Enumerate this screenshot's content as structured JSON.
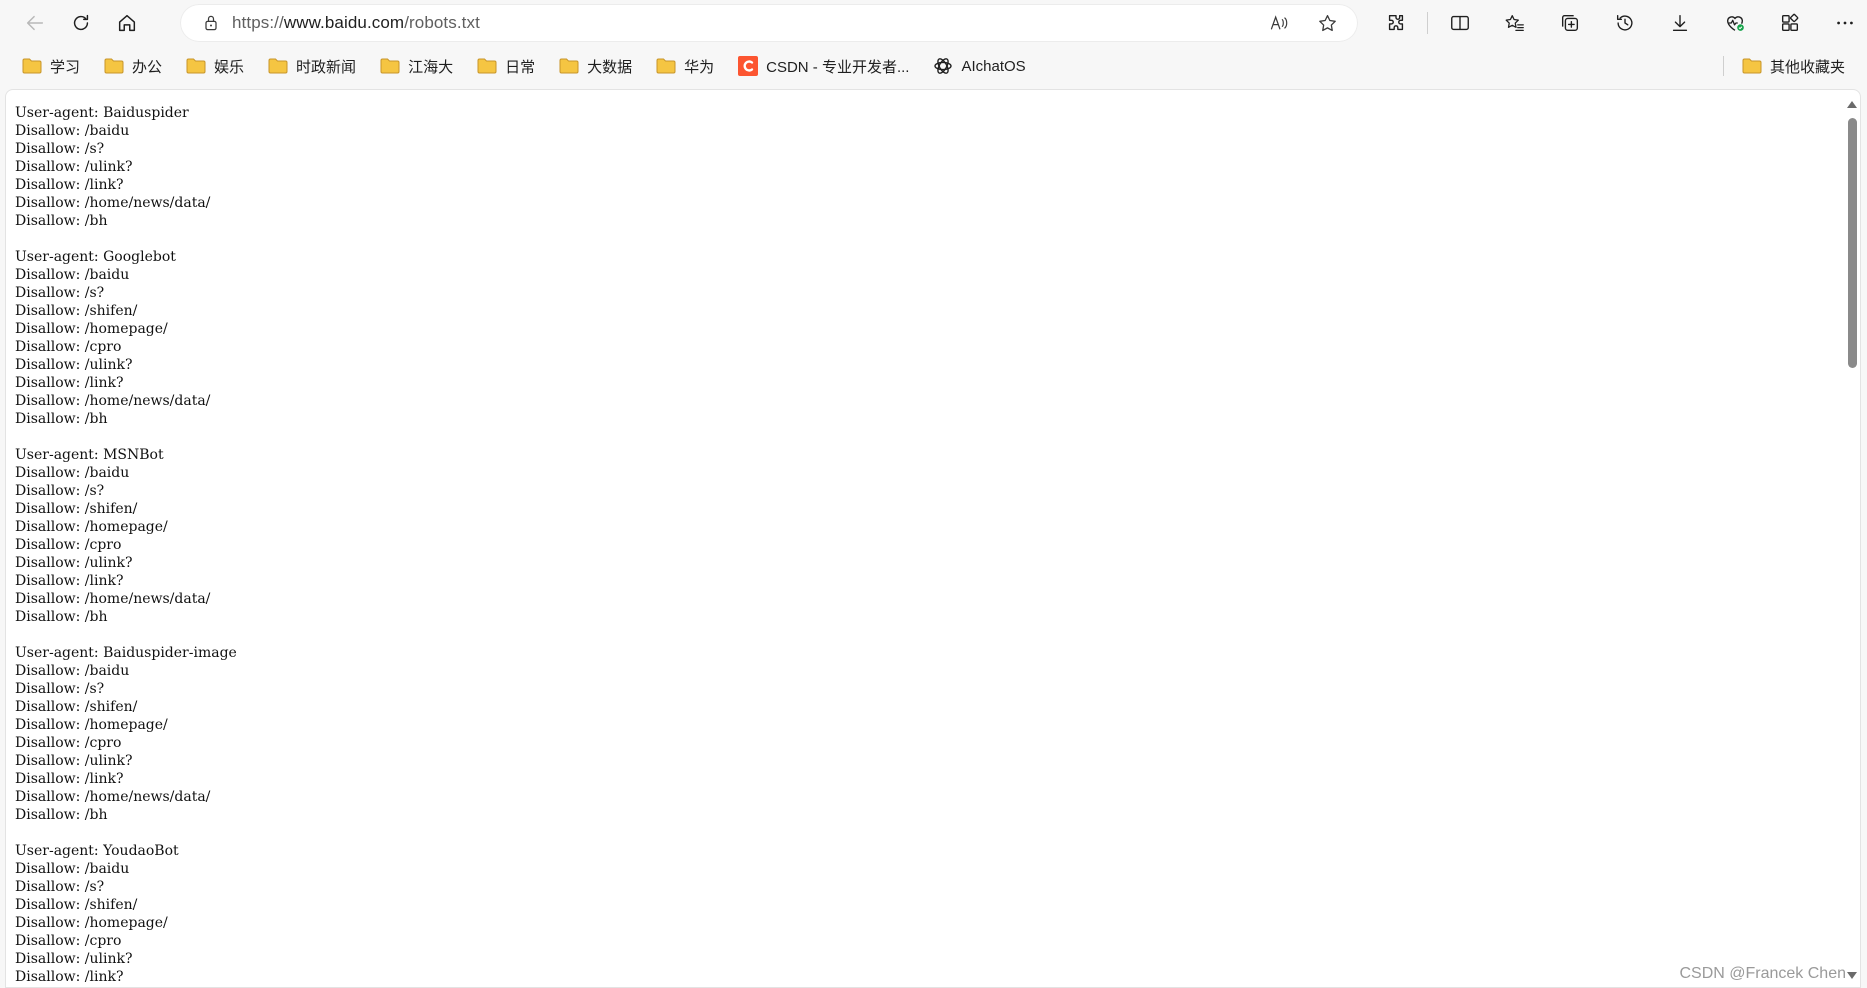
{
  "address_bar": {
    "url_prefix": "https://",
    "url_domain": "www.baidu.com",
    "url_path": "/robots.txt"
  },
  "favorites": [
    {
      "label": "学习",
      "icon": "folder-icon"
    },
    {
      "label": "办公",
      "icon": "folder-icon"
    },
    {
      "label": "娱乐",
      "icon": "folder-icon"
    },
    {
      "label": "时政新闻",
      "icon": "folder-icon"
    },
    {
      "label": "江海大",
      "icon": "folder-icon"
    },
    {
      "label": "日常",
      "icon": "folder-icon"
    },
    {
      "label": "大数据",
      "icon": "folder-icon"
    },
    {
      "label": "华为",
      "icon": "folder-icon"
    },
    {
      "label": "CSDN - 专业开发者...",
      "icon": "csdn-icon"
    },
    {
      "label": "AIchatOS",
      "icon": "openai-icon"
    }
  ],
  "other_favorites": "其他收藏夹",
  "robots_txt": "User-agent: Baiduspider\nDisallow: /baidu\nDisallow: /s?\nDisallow: /ulink?\nDisallow: /link?\nDisallow: /home/news/data/\nDisallow: /bh\n\nUser-agent: Googlebot\nDisallow: /baidu\nDisallow: /s?\nDisallow: /shifen/\nDisallow: /homepage/\nDisallow: /cpro\nDisallow: /ulink?\nDisallow: /link?\nDisallow: /home/news/data/\nDisallow: /bh\n\nUser-agent: MSNBot\nDisallow: /baidu\nDisallow: /s?\nDisallow: /shifen/\nDisallow: /homepage/\nDisallow: /cpro\nDisallow: /ulink?\nDisallow: /link?\nDisallow: /home/news/data/\nDisallow: /bh\n\nUser-agent: Baiduspider-image\nDisallow: /baidu\nDisallow: /s?\nDisallow: /shifen/\nDisallow: /homepage/\nDisallow: /cpro\nDisallow: /ulink?\nDisallow: /link?\nDisallow: /home/news/data/\nDisallow: /bh\n\nUser-agent: YoudaoBot\nDisallow: /baidu\nDisallow: /s?\nDisallow: /shifen/\nDisallow: /homepage/\nDisallow: /cpro\nDisallow: /ulink?\nDisallow: /link?",
  "watermark": "CSDN @Francek Chen",
  "colors": {
    "csdn_red": "#fc5531",
    "folder_yellow": "#f5c542",
    "chrome_bg": "#f7f7f7"
  }
}
